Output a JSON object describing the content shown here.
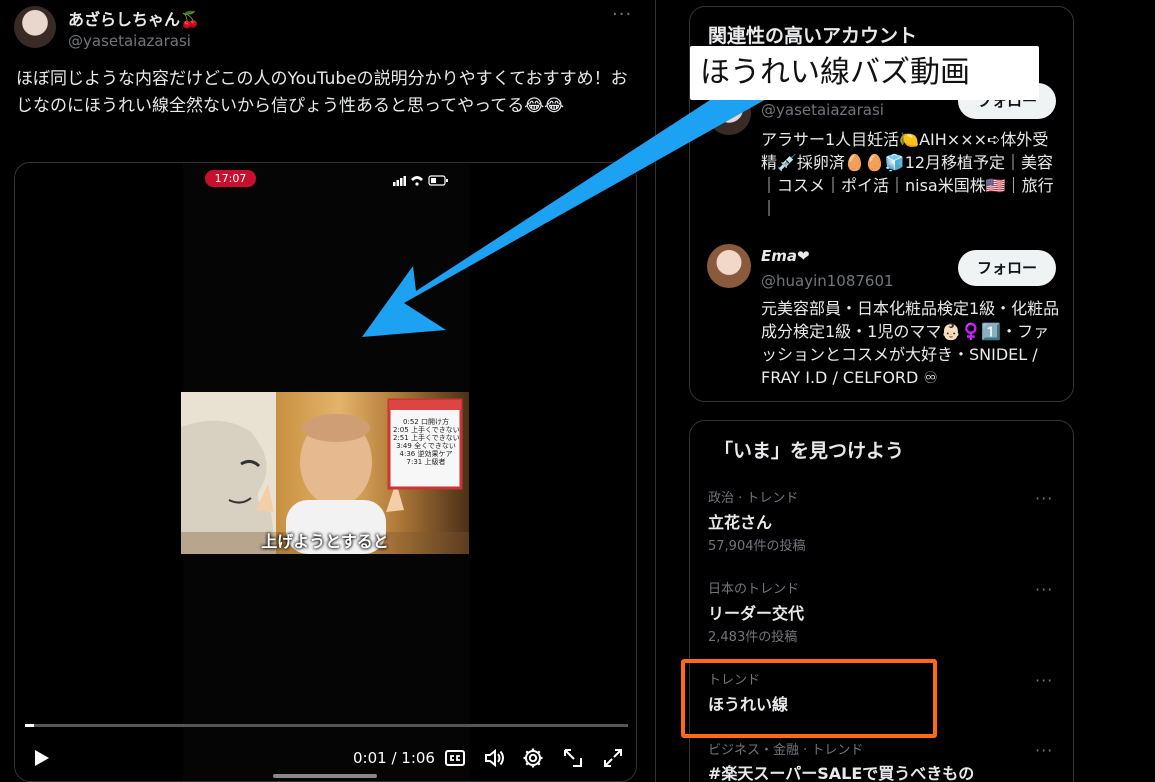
{
  "post": {
    "display_name": "あざらしちゃん🍒",
    "handle": "@yasetaiazarasi",
    "more": "···",
    "text": "ほぼ同じような内容だけどこの人のYouTubeの説明分かりやすくておすすめ！おじなのにほうれい線全然ないから信ぴょう性あると思ってやってる😂😂"
  },
  "video": {
    "status_time": "17:07",
    "caption": "上げようとすると",
    "sign_lines": [
      "0:52 口開け方",
      "2:05 上手くできない",
      "2:51 上手くできない",
      "3:49 全くできない",
      "4:36 逆効果ケア",
      "7:31 上級者"
    ],
    "current_time": "0:01 / 1:06",
    "progress": 0.015
  },
  "sidebar": {
    "related_title": "関連性の高いアカウント",
    "accounts": [
      {
        "name": "",
        "handle": "@yasetaiazarasi",
        "follow_label": "フォロー",
        "bio": "アラサー1人目妊活🍋AIH×××➪体外受精💉採卵済🥚🥚🧊12月移植予定｜美容｜コスメ｜ポイ活｜nisa米国株🇺🇸｜旅行｜"
      },
      {
        "name": "Ema❤",
        "handle": "@huayin1087601",
        "follow_label": "フォロー",
        "bio": "元美容部員・日本化粧品検定1級・化粧品成分検定1級・1児のママ👶🏻♀️1️⃣・ファッションとコスメが大好き・SNIDEL / FRAY I.D / CELFORD ♾"
      }
    ],
    "explore_title": "「いま」を見つけよう",
    "trends": [
      {
        "context": "政治 · トレンド",
        "name": "立花さん",
        "count": "57,904件の投稿"
      },
      {
        "context": "日本のトレンド",
        "name": "リーダー交代",
        "count": "2,483件の投稿"
      },
      {
        "context": "トレンド",
        "name": "ほうれい線",
        "count": ""
      },
      {
        "context": "ビジネス・金融 · トレンド",
        "name": "#楽天スーパーSALEで買うべきもの",
        "count": ""
      }
    ],
    "more": "···"
  },
  "annotation": {
    "label": "ほうれい線バズ動画",
    "arrow_color": "#1da1f2",
    "highlight_color": "#ff6a13"
  }
}
